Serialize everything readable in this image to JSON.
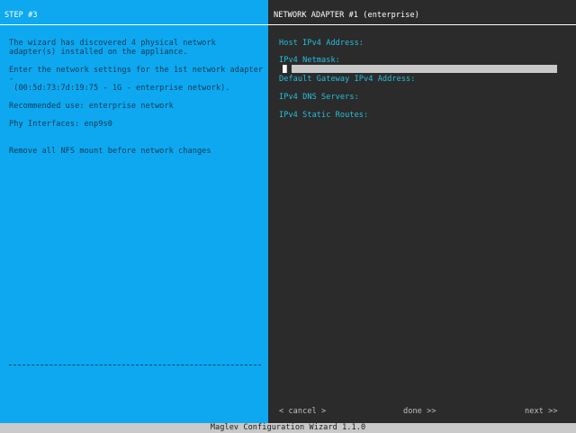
{
  "left_panel": {
    "title": "STEP #3",
    "lines": [
      "The wizard has discovered 4 physical network",
      "adapter(s) installed on the appliance.",
      "Enter the network settings for the 1st network adapter",
      "-",
      " (00:5d:73:7d:19:75 - 1G - enterprise network).",
      "Recommended use: enterprise network",
      "Phy Interfaces: enp9s0",
      "Remove all NFS mount before network changes"
    ]
  },
  "right_panel": {
    "title": "NETWORK ADAPTER #1 (enterprise)",
    "fields": {
      "host_ipv4_address": "Host IPv4 Address:",
      "ipv4_netmask": "IPv4 Netmask:",
      "default_gateway": "Default Gateway IPv4 Address:",
      "ipv4_dns_servers": "IPv4 DNS Servers:",
      "ipv4_static_routes": "IPv4 Static Routes:"
    },
    "buttons": {
      "cancel": "< cancel >",
      "done": "done >>",
      "next": "next >>"
    }
  },
  "status_bar": {
    "text": "Maglev Configuration Wizard 1.1.0"
  },
  "colors": {
    "left_background": "#0da8f0",
    "right_background": "#2b2b2b",
    "field_label": "#24bfdf"
  }
}
